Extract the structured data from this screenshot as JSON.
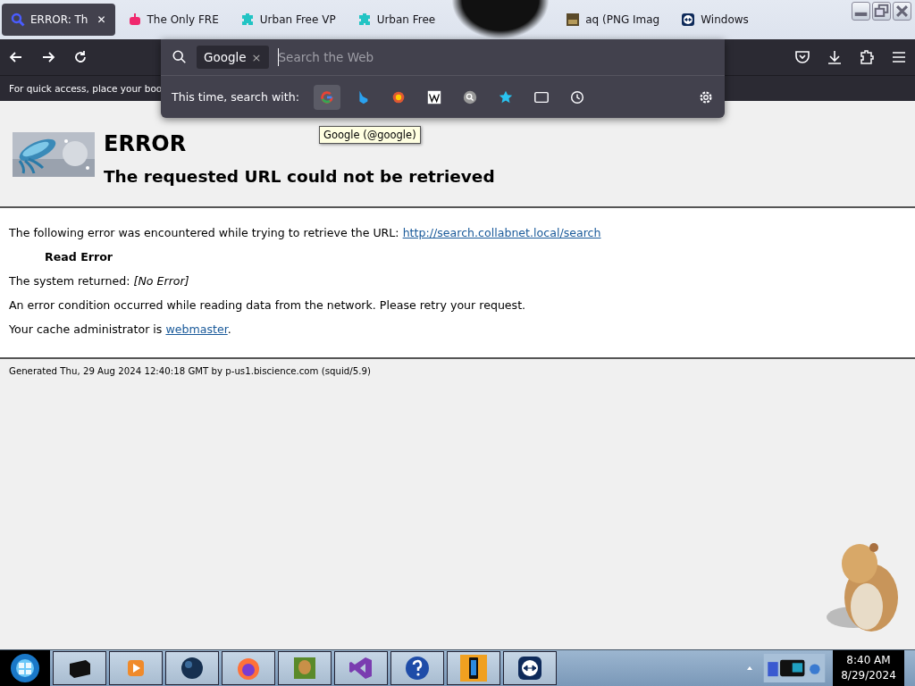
{
  "tabs": [
    {
      "label": "ERROR: Th",
      "selected": true
    },
    {
      "label": "The Only FRE",
      "selected": false
    },
    {
      "label": "Urban Free VP",
      "selected": false
    },
    {
      "label": "Urban Free",
      "selected": false
    },
    {
      "label": "aq (PNG Imag",
      "selected": false
    },
    {
      "label": "Windows",
      "selected": false
    }
  ],
  "tab_close": "✕",
  "bookmarks_hint": "For quick access, place your boo",
  "search_popup": {
    "engine_chip": "Google",
    "chip_close": "×",
    "placeholder": "Search the Web",
    "row_label": "This time, search with:",
    "engines": [
      {
        "selected": true
      },
      {
        "selected": false
      },
      {
        "selected": false
      },
      {
        "selected": false
      },
      {
        "selected": false
      },
      {
        "selected": false
      },
      {
        "selected": false
      },
      {
        "selected": false
      }
    ],
    "tooltip": "Google (@google)"
  },
  "page": {
    "title": "ERROR",
    "subtitle": "The requested URL could not be retrieved",
    "intro": "The following error was encountered while trying to retrieve the URL: ",
    "url": "http://search.collabnet.local/search",
    "error_name": "Read Error",
    "returned_label": "The system returned: ",
    "returned_value": "[No Error]",
    "description": "An error condition occurred while reading data from the network. Please retry your request.",
    "admin_text": "Your cache administrator is ",
    "admin_link": "webmaster",
    "admin_end": ".",
    "footer": "Generated Thu, 29 Aug 2024 12:40:18 GMT by p-us1.biscience.com (squid/5.9)"
  },
  "taskbar": {
    "time": "8:40 AM",
    "date": "8/29/2024"
  }
}
